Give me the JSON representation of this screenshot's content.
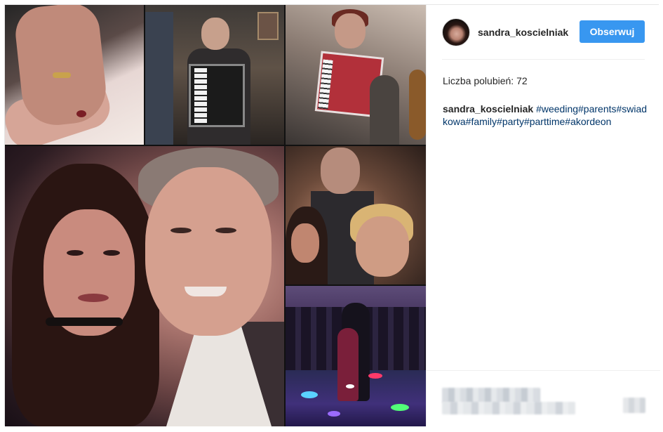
{
  "post": {
    "username": "sandra_koscielniak",
    "follow_label": "Obserwuj",
    "likes_text": "Liczba polubień: 72",
    "caption": {
      "author": "sandra_koscielniak",
      "hashtags": "#weeding#parents#swiadkowa#family#party#parttime#akordeon"
    }
  },
  "colors": {
    "follow_button": "#3897f0",
    "hashtag": "#003569",
    "text": "#262626",
    "border": "#efefef"
  },
  "icons": {
    "avatar": "profile-avatar"
  }
}
